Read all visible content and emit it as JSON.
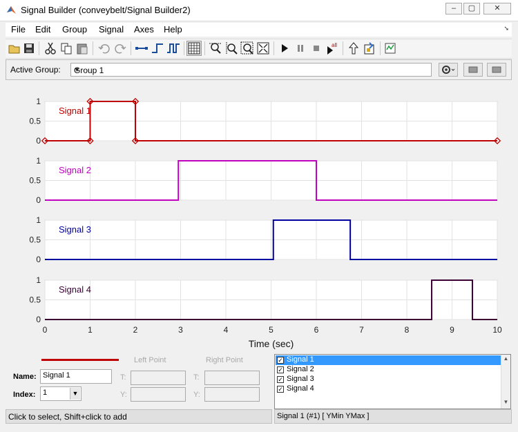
{
  "window": {
    "title": "Signal Builder (conveybelt/Signal Builder2)",
    "controls": {
      "minimize": "–",
      "maximize": "▢",
      "close": "✕"
    }
  },
  "menubar": {
    "items": [
      "File",
      "Edit",
      "Group",
      "Signal",
      "Axes",
      "Help"
    ]
  },
  "toolbar": {
    "icons": [
      "open-icon",
      "save-icon",
      "cut-icon",
      "copy-icon",
      "paste-icon",
      "undo-icon",
      "redo-icon",
      "line-segment-icon",
      "step-up-icon",
      "pulse-icon",
      "grid-icon",
      "zoom-x-icon",
      "zoom-y-icon",
      "zoom-xy-icon",
      "fit-icon",
      "run-icon",
      "pause-icon",
      "stop-icon",
      "run-all-icon",
      "go-to-parent-icon",
      "show-block-icon",
      "help-icon"
    ]
  },
  "group": {
    "label": "Active Group:",
    "selected": "Group 1"
  },
  "chart_data": {
    "type": "line",
    "xlabel": "Time (sec)",
    "xlim": [
      0,
      10
    ],
    "xticks": [
      "0",
      "1",
      "2",
      "3",
      "4",
      "5",
      "6",
      "7",
      "8",
      "9",
      "10"
    ],
    "ylim": [
      0,
      1
    ],
    "yticks": [
      "0",
      "0.5",
      "1"
    ],
    "grid": true,
    "series": [
      {
        "name": "Signal 1",
        "color": "#c00000",
        "x": [
          0,
          1,
          1,
          2,
          2,
          10
        ],
        "y": [
          0,
          0,
          1,
          1,
          0,
          0
        ]
      },
      {
        "name": "Signal 2",
        "color": "#bf00bf",
        "x": [
          0,
          2.95,
          2.95,
          6.0,
          6.0,
          10
        ],
        "y": [
          0,
          0,
          1,
          1,
          0,
          0
        ]
      },
      {
        "name": "Signal 3",
        "color": "#00009f",
        "x": [
          0,
          5.05,
          5.05,
          6.75,
          6.75,
          10
        ],
        "y": [
          0,
          0,
          1,
          1,
          0,
          0
        ]
      },
      {
        "name": "Signal 4",
        "color": "#3c0035",
        "x": [
          0,
          8.55,
          8.55,
          9.45,
          9.45,
          10
        ],
        "y": [
          0,
          0,
          1,
          1,
          0,
          0
        ]
      }
    ]
  },
  "editor": {
    "left_point": "Left Point",
    "right_point": "Right Point",
    "t_label": "T:",
    "y_label": "Y:",
    "name_label": "Name:",
    "name_value": "Signal 1",
    "index_label": "Index:",
    "index_value": "1"
  },
  "signal_list": [
    {
      "label": "Signal 1",
      "checked": true,
      "selected": true
    },
    {
      "label": "Signal 2",
      "checked": true,
      "selected": false
    },
    {
      "label": "Signal 3",
      "checked": true,
      "selected": false
    },
    {
      "label": "Signal 4",
      "checked": true,
      "selected": false
    }
  ],
  "status": {
    "left": "Click to select, Shift+click to add",
    "right": "Signal 1 (#1)  [ YMin YMax ]"
  }
}
